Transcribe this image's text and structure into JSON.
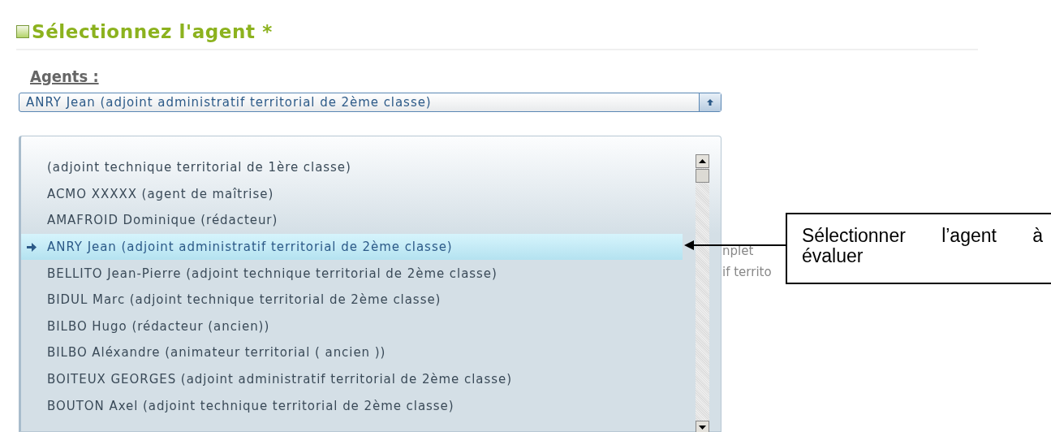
{
  "section": {
    "title": "Sélectionnez l'agent *"
  },
  "field": {
    "label": "Agents :",
    "value": "ANRY Jean (adjoint administratif territorial de 2ème classe)",
    "expanded": true
  },
  "options": [
    {
      "label": "(adjoint technique territorial de 1ère classe)",
      "selected": false
    },
    {
      "label": "ACMO XXXXX (agent de maîtrise)",
      "selected": false
    },
    {
      "label": "AMAFROID Dominique (rédacteur)",
      "selected": false
    },
    {
      "label": "ANRY Jean (adjoint administratif territorial de 2ème classe)",
      "selected": true
    },
    {
      "label": "BELLITO Jean-Pierre (adjoint technique territorial de 2ème classe)",
      "selected": false
    },
    {
      "label": "BIDUL Marc (adjoint technique territorial de 2ème classe)",
      "selected": false
    },
    {
      "label": "BILBO Hugo (rédacteur (ancien))",
      "selected": false
    },
    {
      "label": "BILBO Aléxandre (animateur territorial ( ancien ))",
      "selected": false
    },
    {
      "label": "BOITEUX GEORGES (adjoint administratif territorial de 2ème classe)",
      "selected": false
    },
    {
      "label": "BOUTON Axel (adjoint technique territorial de 2ème classe)",
      "selected": false
    }
  ],
  "behind_texts": [
    "nplet",
    "if territo"
  ],
  "callout": {
    "text": "Sélectionner l’agent à évaluer"
  }
}
